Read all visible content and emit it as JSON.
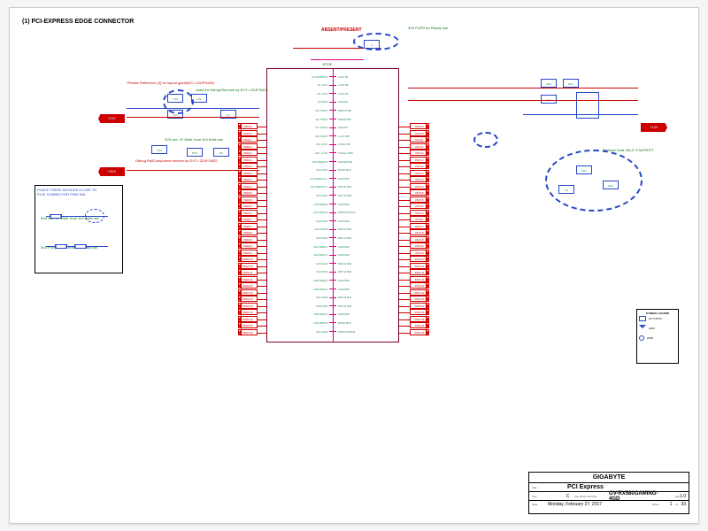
{
  "sheet_title": "(1) PCI-EXPRESS EDGE CONNECTOR",
  "top_center_note": "ABSENT/PRESENT",
  "top_right_note": "3V3 P1/P2 for Ready use",
  "connector_refdes": "JPCIE",
  "connector_part": "PCIE164PA",
  "pins_left": [
    {
      "n": "A1",
      "name": "PRSNT1#"
    },
    {
      "n": "A2",
      "name": "+12V"
    },
    {
      "n": "A3",
      "name": "+12V"
    },
    {
      "n": "A4",
      "name": "GND"
    },
    {
      "n": "A5",
      "name": "JTAG2"
    },
    {
      "n": "A6",
      "name": "JTAG3"
    },
    {
      "n": "A7",
      "name": "JTAG4"
    },
    {
      "n": "A8",
      "name": "JTAG5"
    },
    {
      "n": "A9",
      "name": "+3.3V"
    },
    {
      "n": "A10",
      "name": "+3.3V"
    },
    {
      "n": "A11",
      "name": "PERST#"
    },
    {
      "n": "A12",
      "name": "GND"
    },
    {
      "n": "A13",
      "name": "REFCLK+"
    },
    {
      "n": "A14",
      "name": "REFCLK-"
    },
    {
      "n": "A15",
      "name": "GND"
    },
    {
      "n": "A16",
      "name": "PERp0"
    },
    {
      "n": "A17",
      "name": "PERn0"
    },
    {
      "n": "A18",
      "name": "GND"
    },
    {
      "n": "A19",
      "name": "RSVD"
    },
    {
      "n": "A20",
      "name": "GND"
    },
    {
      "n": "A21",
      "name": "PERp1"
    },
    {
      "n": "A22",
      "name": "PERn1"
    },
    {
      "n": "A23",
      "name": "GND"
    },
    {
      "n": "A24",
      "name": "GND"
    },
    {
      "n": "A25",
      "name": "PERp2"
    },
    {
      "n": "A26",
      "name": "PERn2"
    },
    {
      "n": "A27",
      "name": "GND"
    },
    {
      "n": "A28",
      "name": "GND"
    },
    {
      "n": "A29",
      "name": "PERp3"
    },
    {
      "n": "A30",
      "name": "PERn3"
    },
    {
      "n": "A31",
      "name": "GND"
    }
  ],
  "pins_right": [
    {
      "n": "B1",
      "name": "+12V"
    },
    {
      "n": "B2",
      "name": "+12V"
    },
    {
      "n": "B3",
      "name": "+12V"
    },
    {
      "n": "B4",
      "name": "GND"
    },
    {
      "n": "B5",
      "name": "SMCLK"
    },
    {
      "n": "B6",
      "name": "SMDAT"
    },
    {
      "n": "B7",
      "name": "GND"
    },
    {
      "n": "B8",
      "name": "+3.3V"
    },
    {
      "n": "B9",
      "name": "JTAG1"
    },
    {
      "n": "B10",
      "name": "3.3Vaux"
    },
    {
      "n": "B11",
      "name": "WAKE#"
    },
    {
      "n": "B12",
      "name": "RSVD"
    },
    {
      "n": "B13",
      "name": "GND"
    },
    {
      "n": "B14",
      "name": "PETp0"
    },
    {
      "n": "B15",
      "name": "PETn0"
    },
    {
      "n": "B16",
      "name": "GND"
    },
    {
      "n": "B17",
      "name": "PRSNT2#"
    },
    {
      "n": "B18",
      "name": "GND"
    },
    {
      "n": "B19",
      "name": "PETp1"
    },
    {
      "n": "B20",
      "name": "PETn1"
    },
    {
      "n": "B21",
      "name": "GND"
    },
    {
      "n": "B22",
      "name": "GND"
    },
    {
      "n": "B23",
      "name": "PETp2"
    },
    {
      "n": "B24",
      "name": "PETn2"
    },
    {
      "n": "B25",
      "name": "GND"
    },
    {
      "n": "B26",
      "name": "GND"
    },
    {
      "n": "B27",
      "name": "PETp3"
    },
    {
      "n": "B28",
      "name": "PETn3"
    },
    {
      "n": "B29",
      "name": "GND"
    },
    {
      "n": "B30",
      "name": "RSVD"
    },
    {
      "n": "B31",
      "name": "PRSNT2#"
    }
  ],
  "lane_nets_left": [
    "PERp0",
    "PERn0",
    "PERp1",
    "PERn1",
    "PERp2",
    "PERn2",
    "PERp3",
    "PERn3",
    "PERp4",
    "PERn4",
    "PERp5",
    "PERn5",
    "PERp6",
    "PERn6",
    "PERp7",
    "PERn7",
    "PERp8",
    "PERn8",
    "PERp9",
    "PERn9",
    "PERp10",
    "PERn10",
    "PERp11",
    "PERn11",
    "PERp12",
    "PERn12",
    "PERp13",
    "PERn13",
    "PERp14",
    "PERn14",
    "PERp15",
    "PERn15"
  ],
  "lane_nets_right": [
    "PETp0",
    "PETn0",
    "PETp1",
    "PETn1",
    "PETp2",
    "PETn2",
    "PETp3",
    "PETn3",
    "PETp4",
    "PETn4",
    "PETp5",
    "PETn5",
    "PETp6",
    "PETn6",
    "PETp7",
    "PETn7",
    "PETp8",
    "PETn8",
    "PETp9",
    "PETn9",
    "PETp10",
    "PETn10",
    "PETp11",
    "PETn11",
    "PETp12",
    "PETn12",
    "PETp13",
    "PETn13",
    "PETp14",
    "PETn14",
    "PETp15",
    "PETn15"
  ],
  "ports_left": [
    "+12V",
    "+3V3"
  ],
  "ports_right": [
    "+12V"
  ],
  "upper_left_group": {
    "note1": "*Please Reference [X] for layout guide(DC=.22UF/0402)",
    "note2": "Used for Debug Remove by DVT=.22UF/0402",
    "components": [
      "C10",
      "C11",
      "C12",
      "R1",
      "R2",
      "U1"
    ]
  },
  "lower_left_group": {
    "note1": "3V3 use .47 Multi. from 3v3 Exist use",
    "note2": "Debug RailComponent remove by DVT=.22UF/0402",
    "components": [
      "C13",
      "C14",
      "R3",
      "R4",
      "IPS1"
    ]
  },
  "notes_box_lines": [
    "PLACE THESE DEVICES CLOSE TO",
    "PCIE CONNECTOR PINS N/A",
    "",
    "3V3 use .47 Multi. from 3v3 Exist use",
    "",
    "3V3 P1/P2 Multi. from 3v3 Exist use"
  ],
  "right_group": {
    "mosfet_notes": "Reserve Dual JNLZ *2 MOSFET",
    "components": [
      "R26",
      "R27",
      "C1",
      "C2",
      "CR1",
      "CR2",
      "PU1"
    ]
  },
  "legend_title": "SYMBOL LEGEND",
  "legend_items": [
    "NO STUFF",
    "GND",
    "PWR"
  ],
  "titleblock": {
    "company": "GIGABYTE",
    "title_label": "Title",
    "title": "PCI Express",
    "doc_label": "Document Number",
    "doc": "GV-RX580GAMING-4GD",
    "date_label": "Date:",
    "date": "Monday, February 27, 2017",
    "sheet_label": "Sheet",
    "sheet": "1",
    "of_label": "of",
    "of": "33",
    "size_label": "Size",
    "size": "C",
    "rev_label": "Rev",
    "rev": "1.0"
  }
}
